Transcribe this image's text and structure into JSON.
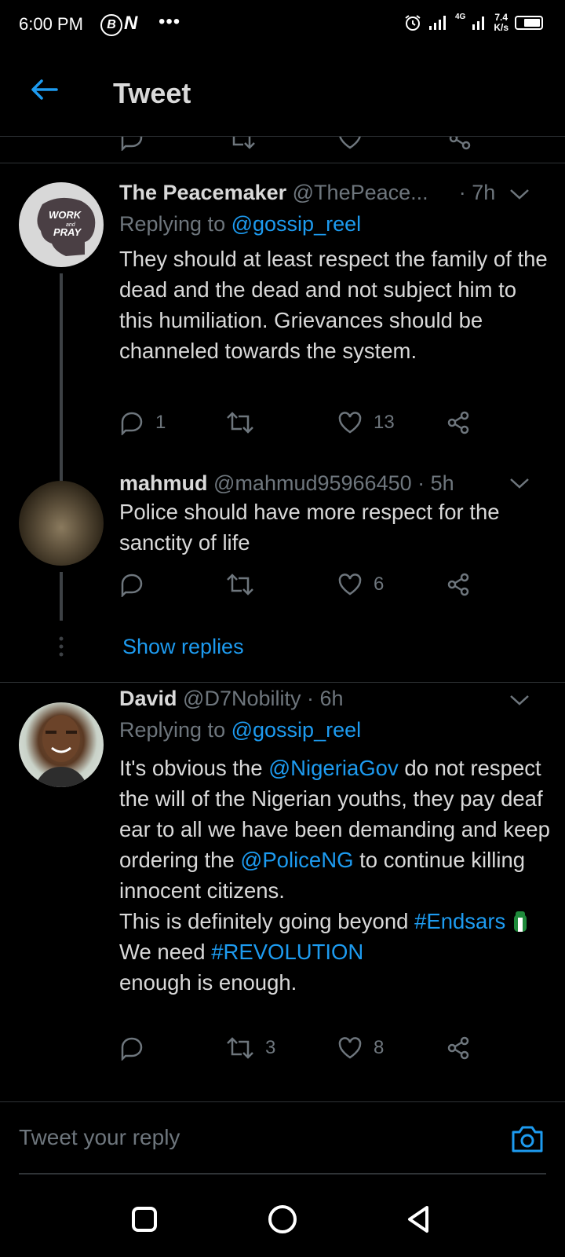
{
  "status_bar": {
    "time": "6:00 PM",
    "badge_b": "B",
    "badge_n": "N",
    "dots": "•••",
    "network": "4G",
    "speed_value": "7.4",
    "speed_unit": "K/s"
  },
  "header": {
    "title": "Tweet"
  },
  "tweets": [
    {
      "name": "The Peacemaker",
      "handle": "@ThePeace...",
      "dot": "·",
      "time": "7h",
      "replying_prefix": "Replying to",
      "replying_to": "@gossip_reel",
      "avatar_text_1": "WORK",
      "avatar_text_2": "and",
      "avatar_text_3": "PRAY",
      "text": "They should at least respect the family of the dead and the dead and not subject him to this humiliation. Grievances should be channeled towards the system.",
      "replies": "1",
      "retweets": "",
      "likes": "13"
    },
    {
      "name": "mahmud",
      "handle": "@mahmud95966450",
      "dot": "·",
      "time": "5h",
      "text": "Police should have more respect for the sanctity of life",
      "replies": "",
      "retweets": "",
      "likes": "6"
    },
    {
      "name": "David",
      "handle": "@D7Nobility",
      "dot": "·",
      "time": "6h",
      "replying_prefix": "Replying to",
      "replying_to": "@gossip_reel",
      "text_part1": "It's obvious the ",
      "mention1": "@NigeriaGov",
      "text_part2": " do not respect the will of the Nigerian youths, they pay deaf ear to all we have been demanding and keep ordering the ",
      "mention2": "@PoliceNG",
      "text_part3": " to continue killing innocent citizens.",
      "text_part4": "This is definitely going beyond ",
      "hashtag1": "#Endsars",
      "text_part5": " We need ",
      "hashtag2": "#REVOLUTION",
      "text_part6": "enough is enough.",
      "replies": "",
      "retweets": "3",
      "likes": "8"
    }
  ],
  "show_replies": "Show replies",
  "compose": {
    "placeholder": "Tweet your reply"
  },
  "icons": {
    "back": "arrow-left-icon",
    "reply": "reply-icon",
    "retweet": "retweet-icon",
    "like": "heart-icon",
    "share": "share-icon",
    "more": "chevron-down-icon",
    "camera": "camera-icon"
  },
  "colors": {
    "background": "#000000",
    "accent": "#1d9bf0",
    "muted": "#6e767d",
    "text": "#d9d9d9",
    "divider": "#2f3336"
  }
}
